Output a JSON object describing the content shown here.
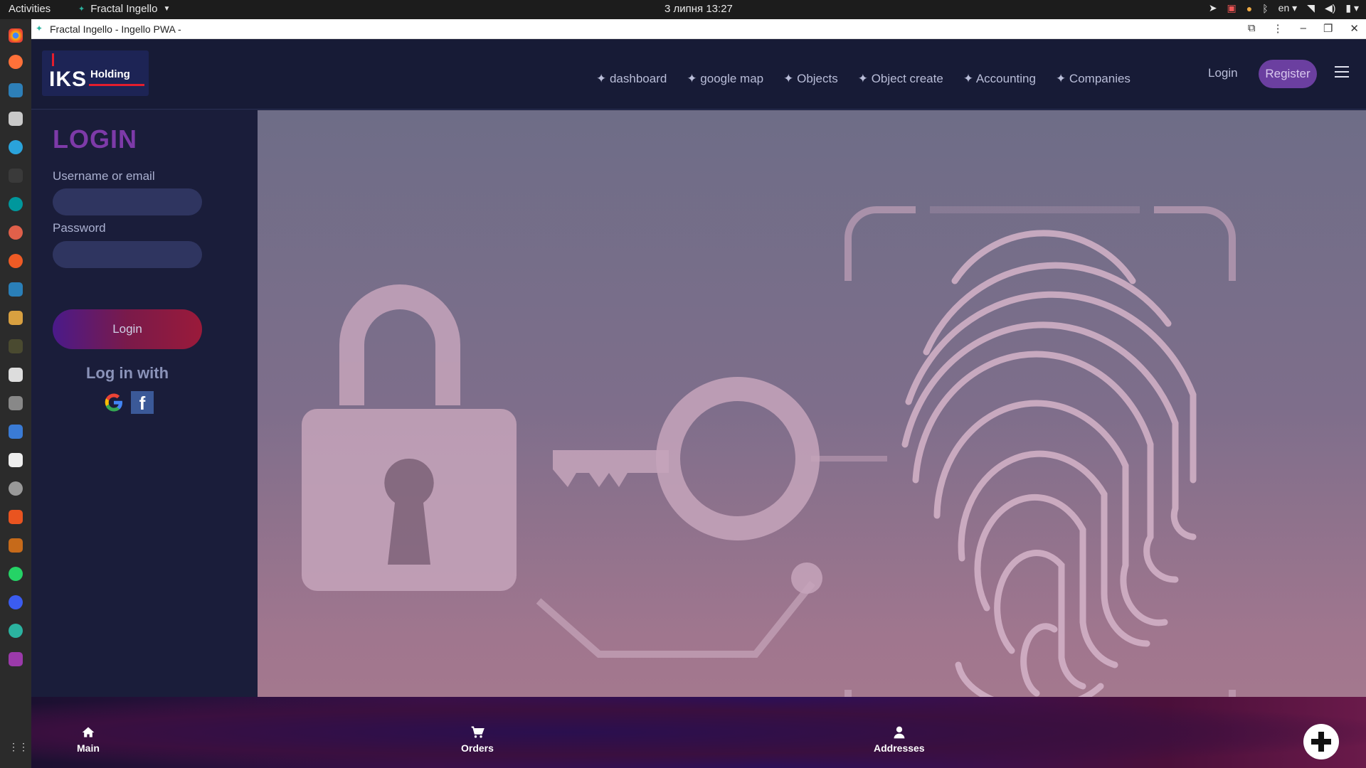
{
  "system": {
    "activities": "Activities",
    "app_name": "Fractal Ingello",
    "clock": "3 липня  13:27",
    "lang": "en"
  },
  "browser": {
    "title": "Fractal Ingello - Ingello PWA -"
  },
  "header": {
    "logo_main": "IKS",
    "logo_sub": "Holding",
    "menu": [
      "✦ dashboard",
      "✦ google map",
      "✦ Objects",
      "✦ Object create",
      "✦ Accounting",
      "✦ Companies"
    ],
    "login": "Login",
    "register": "Register"
  },
  "login_panel": {
    "title": "LOGIN",
    "username_label": "Username or email",
    "password_label": "Password",
    "button": "Login",
    "log_in_with": "Log in with"
  },
  "bottom_nav": {
    "items": [
      {
        "label": "Main",
        "icon": "home-icon"
      },
      {
        "label": "Orders",
        "icon": "cart-icon"
      },
      {
        "label": "Addresses",
        "icon": "user-icon"
      }
    ]
  },
  "colors": {
    "accent": "#6b3fa0",
    "title": "#7d3aa8",
    "nav_bg": "#171b36"
  }
}
